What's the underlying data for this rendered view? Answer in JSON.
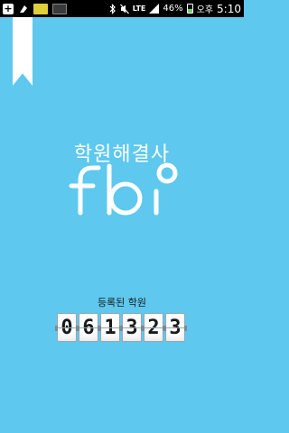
{
  "status_bar": {
    "lte_label": "LTE",
    "battery_percent": "46%",
    "am_pm": "오후",
    "time": "5:10",
    "battery_level": 0.46,
    "icons": [
      "plus-icon",
      "app-thumbnail",
      "app-thumbnail",
      "app-thumbnail",
      "bluetooth-icon",
      "mute-icon",
      "lte-icon",
      "signal-icon",
      "battery-icon"
    ]
  },
  "splash": {
    "tagline": "학원해결사",
    "logo_text": "fbi",
    "registered_label": "등록된 학원",
    "counter_digits": [
      "0",
      "6",
      "1",
      "3",
      "2",
      "3"
    ]
  },
  "colors": {
    "background": "#5ec8ee",
    "logo": "#ffffff",
    "status_bar": "#000000"
  }
}
